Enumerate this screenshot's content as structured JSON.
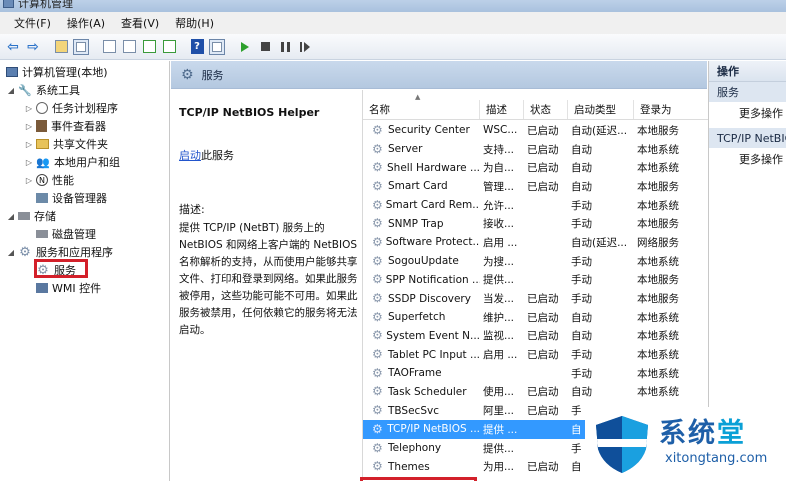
{
  "window": {
    "title": "计算机管理"
  },
  "menu": [
    "文件(F)",
    "操作(A)",
    "查看(V)",
    "帮助(H)"
  ],
  "tree": {
    "root": "计算机管理(本地)",
    "system_tools": "系统工具",
    "task_scheduler": "任务计划程序",
    "event_viewer": "事件查看器",
    "shared_folders": "共享文件夹",
    "local_users": "本地用户和组",
    "performance": "性能",
    "device_manager": "设备管理器",
    "storage": "存储",
    "disk_management": "磁盘管理",
    "services_apps": "服务和应用程序",
    "services": "服务",
    "wmi": "WMI 控件"
  },
  "middle": {
    "header": "服务",
    "service_title": "TCP/IP NetBIOS Helper",
    "start_link": "启动",
    "start_suffix": "此服务",
    "desc_label": "描述:",
    "desc_body": "提供 TCP/IP (NetBT) 服务上的 NetBIOS 和网络上客户端的 NetBIOS 名称解析的支持，从而使用户能够共享文件、打印和登录到网络。如果此服务被停用，这些功能可能不可用。如果此服务被禁用，任何依赖它的服务将无法启动。"
  },
  "list": {
    "columns": [
      "名称",
      "描述",
      "状态",
      "启动类型",
      "登录为"
    ],
    "rows": [
      [
        "Security Center",
        "WSC...",
        "已启动",
        "自动(延迟...",
        "本地服务"
      ],
      [
        "Server",
        "支持...",
        "已启动",
        "自动",
        "本地系统"
      ],
      [
        "Shell Hardware ...",
        "为自...",
        "已启动",
        "自动",
        "本地系统"
      ],
      [
        "Smart Card",
        "管理...",
        "已启动",
        "自动",
        "本地服务"
      ],
      [
        "Smart Card Rem...",
        "允许...",
        "",
        "手动",
        "本地系统"
      ],
      [
        "SNMP Trap",
        "接收...",
        "",
        "手动",
        "本地服务"
      ],
      [
        "Software Protect...",
        "启用 ...",
        "",
        "自动(延迟...",
        "网络服务"
      ],
      [
        "SogouUpdate",
        "为搜...",
        "",
        "手动",
        "本地系统"
      ],
      [
        "SPP Notification ...",
        "提供...",
        "",
        "手动",
        "本地服务"
      ],
      [
        "SSDP Discovery",
        "当发...",
        "已启动",
        "手动",
        "本地服务"
      ],
      [
        "Superfetch",
        "维护...",
        "已启动",
        "自动",
        "本地系统"
      ],
      [
        "System Event N...",
        "监视...",
        "已启动",
        "自动",
        "本地系统"
      ],
      [
        "Tablet PC Input ...",
        "启用 ...",
        "已启动",
        "手动",
        "本地系统"
      ],
      [
        "TAOFrame",
        "",
        "",
        "手动",
        "本地系统"
      ],
      [
        "Task Scheduler",
        "使用...",
        "已启动",
        "自动",
        "本地系统"
      ],
      [
        "TBSecSvc",
        "阿里...",
        "已启动",
        "手",
        ""
      ],
      [
        "TCP/IP NetBIOS ...",
        "提供 ...",
        "",
        "自",
        ""
      ],
      [
        "Telephony",
        "提供...",
        "",
        "手",
        ""
      ],
      [
        "Themes",
        "为用...",
        "已启动",
        "自",
        ""
      ]
    ],
    "selected_index": 16
  },
  "actions": {
    "header": "操作",
    "section1": "服务",
    "more1": "更多操作",
    "section2": "TCP/IP NetBIOS Helper",
    "more2": "更多操作"
  },
  "watermark": {
    "chars": [
      "系",
      "统",
      "堂"
    ],
    "url": "xitongtang.com"
  },
  "colors": {
    "highlight_red": "#d3202a",
    "selection_blue": "#3399ff",
    "link_blue": "#2255cc",
    "logo_blue": "#1e5fa8"
  }
}
